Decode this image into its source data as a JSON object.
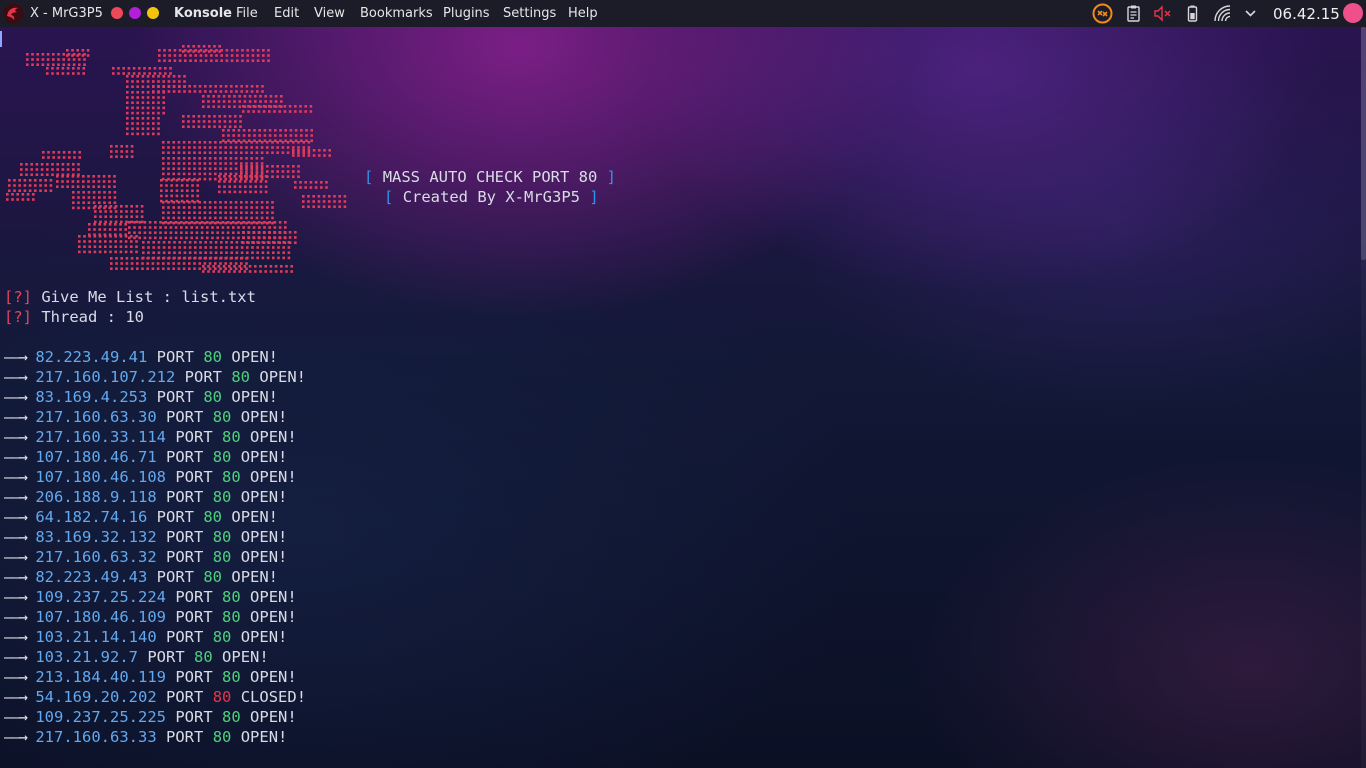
{
  "topbar": {
    "window_title": "X - MrG3P5",
    "app_name": "Konsole",
    "menus": [
      "File",
      "Edit",
      "View",
      "Bookmarks",
      "Plugins",
      "Settings",
      "Help"
    ],
    "clock": "06.42.15",
    "tray_icons": [
      "sync-icon",
      "clipboard-icon",
      "volume-muted-icon",
      "battery-icon",
      "wifi-icon",
      "chevron-down-icon"
    ],
    "window_dots": [
      "#ee4958",
      "#b11fd8",
      "#f2c40e"
    ]
  },
  "terminal": {
    "banner": {
      "title_open": "[",
      "title": "MASS AUTO CHECK PORT 80",
      "title_close": "]",
      "subtitle_open": "[",
      "subtitle": "Created By X-MrG3P5",
      "subtitle_close": "]"
    },
    "prompts": [
      {
        "mark": "[?]",
        "text": "Give Me List : list.txt"
      },
      {
        "mark": "[?]",
        "text": "Thread : 10"
      }
    ],
    "results": [
      {
        "arrow": "——→",
        "ip": "82.223.49.41",
        "port_label": "PORT",
        "port": "80",
        "status": "OPEN!"
      },
      {
        "arrow": "——→",
        "ip": "217.160.107.212",
        "port_label": "PORT",
        "port": "80",
        "status": "OPEN!"
      },
      {
        "arrow": "——→",
        "ip": "83.169.4.253",
        "port_label": "PORT",
        "port": "80",
        "status": "OPEN!"
      },
      {
        "arrow": "——→",
        "ip": "217.160.63.30",
        "port_label": "PORT",
        "port": "80",
        "status": "OPEN!"
      },
      {
        "arrow": "——→",
        "ip": "217.160.33.114",
        "port_label": "PORT",
        "port": "80",
        "status": "OPEN!"
      },
      {
        "arrow": "——→",
        "ip": "107.180.46.71",
        "port_label": "PORT",
        "port": "80",
        "status": "OPEN!"
      },
      {
        "arrow": "——→",
        "ip": "107.180.46.108",
        "port_label": "PORT",
        "port": "80",
        "status": "OPEN!"
      },
      {
        "arrow": "——→",
        "ip": "206.188.9.118",
        "port_label": "PORT",
        "port": "80",
        "status": "OPEN!"
      },
      {
        "arrow": "——→",
        "ip": "64.182.74.16",
        "port_label": "PORT",
        "port": "80",
        "status": "OPEN!"
      },
      {
        "arrow": "——→",
        "ip": "83.169.32.132",
        "port_label": "PORT",
        "port": "80",
        "status": "OPEN!"
      },
      {
        "arrow": "——→",
        "ip": "217.160.63.32",
        "port_label": "PORT",
        "port": "80",
        "status": "OPEN!"
      },
      {
        "arrow": "——→",
        "ip": "82.223.49.43",
        "port_label": "PORT",
        "port": "80",
        "status": "OPEN!"
      },
      {
        "arrow": "——→",
        "ip": "109.237.25.224",
        "port_label": "PORT",
        "port": "80",
        "status": "OPEN!"
      },
      {
        "arrow": "——→",
        "ip": "107.180.46.109",
        "port_label": "PORT",
        "port": "80",
        "status": "OPEN!"
      },
      {
        "arrow": "——→",
        "ip": "103.21.14.140",
        "port_label": "PORT",
        "port": "80",
        "status": "OPEN!"
      },
      {
        "arrow": "——→",
        "ip": "103.21.92.7",
        "port_label": "PORT",
        "port": "80",
        "status": "OPEN!"
      },
      {
        "arrow": "——→",
        "ip": "213.184.40.119",
        "port_label": "PORT",
        "port": "80",
        "status": "OPEN!"
      },
      {
        "arrow": "——→",
        "ip": "54.169.20.202",
        "port_label": "PORT",
        "port": "80",
        "status": "CLOSED!"
      },
      {
        "arrow": "——→",
        "ip": "109.237.25.225",
        "port_label": "PORT",
        "port": "80",
        "status": "OPEN!"
      },
      {
        "arrow": "——→",
        "ip": "217.160.63.33",
        "port_label": "PORT",
        "port": "80",
        "status": "OPEN!"
      }
    ],
    "colors": {
      "ascii_art": "#e03a5a",
      "ip": "#62a9f0",
      "port_open": "#4ed07d",
      "port_closed": "#e8344b",
      "bracket": "#2e95e8"
    }
  }
}
